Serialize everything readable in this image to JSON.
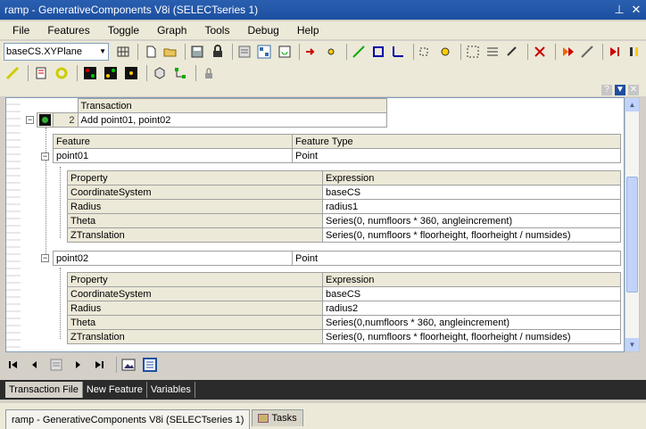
{
  "window": {
    "title": "ramp - GenerativeComponents V8i (SELECTseries 1)",
    "pin_glyph": "⊥",
    "close_glyph": "✕"
  },
  "menu": [
    "File",
    "Features",
    "Toggle",
    "Graph",
    "Tools",
    "Debug",
    "Help"
  ],
  "toolbar": {
    "plane_combo": "baseCS.XYPlane"
  },
  "panel": {
    "help_glyph": "?",
    "dropdown_glyph": "▼",
    "close_glyph": "✕"
  },
  "transaction": {
    "header": "Transaction",
    "number": "2",
    "label": "Add point01, point02"
  },
  "feature_table": {
    "headers": [
      "Feature",
      "Feature Type"
    ],
    "features": [
      {
        "name": "point01",
        "type": "Point",
        "prop_headers": [
          "Property",
          "Expression"
        ],
        "properties": [
          [
            "CoordinateSystem",
            "baseCS"
          ],
          [
            "Radius",
            "radius1"
          ],
          [
            "Theta",
            "Series(0, numfloors * 360, angleincrement)"
          ],
          [
            "ZTranslation",
            "Series(0, numfloors * floorheight, floorheight / numsides)"
          ]
        ]
      },
      {
        "name": "point02",
        "type": "Point",
        "prop_headers": [
          "Property",
          "Expression"
        ],
        "properties": [
          [
            "CoordinateSystem",
            "baseCS"
          ],
          [
            "Radius",
            "radius2"
          ],
          [
            "Theta",
            "Series(0,numfloors * 360,  angleincrement)"
          ],
          [
            "ZTranslation",
            "Series(0, numfloors * floorheight, floorheight / numsides)"
          ]
        ]
      }
    ]
  },
  "bottom_tabs": [
    "Transaction File",
    "New Feature",
    "Variables"
  ],
  "taskbar": [
    "ramp - GenerativeComponents V8i (SELECTseries 1)",
    "Tasks"
  ],
  "colors": {
    "title_bg": "#1d4fa0",
    "tab_strip": "#2b2b2b",
    "active_green": "#2fb02f"
  }
}
